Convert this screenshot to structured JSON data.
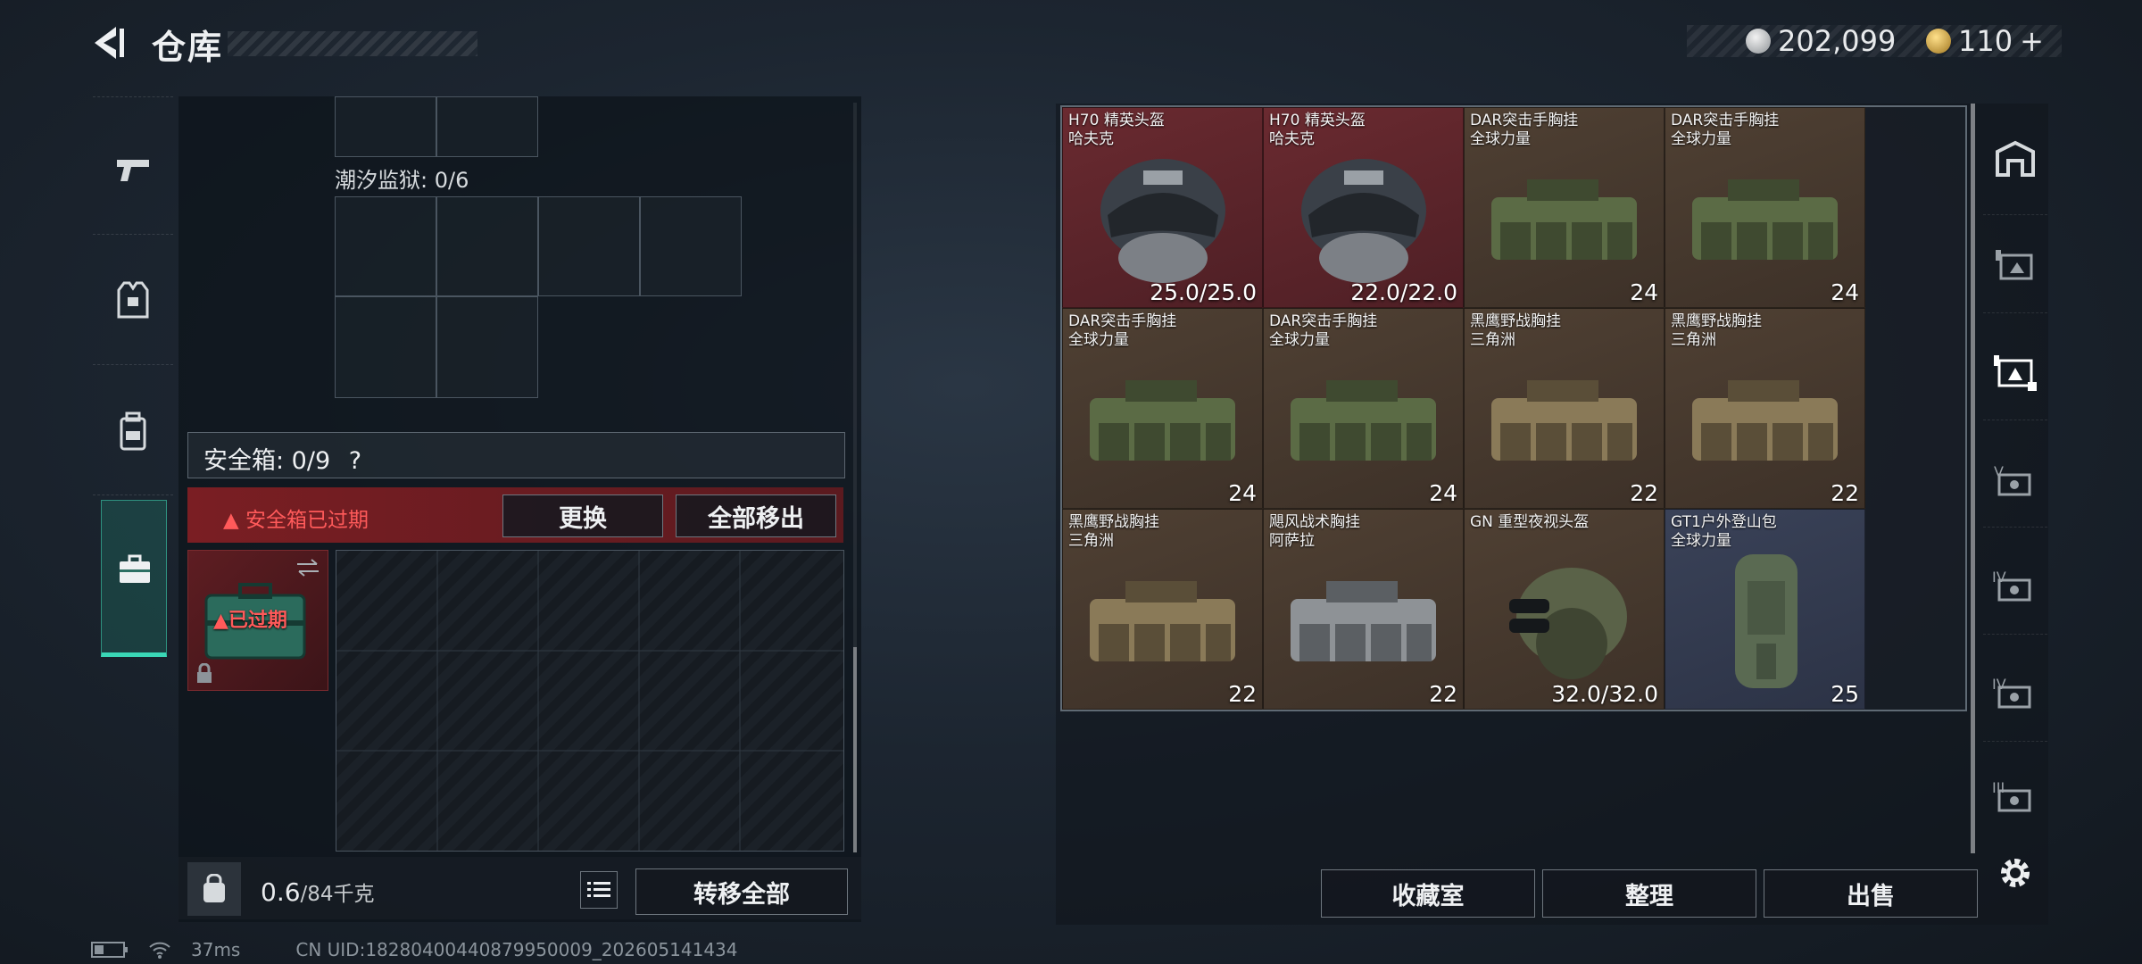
{
  "header": {
    "title": "仓库",
    "currency_silver": "202,099",
    "currency_gold": "110",
    "plus": "+"
  },
  "left_panel": {
    "tide_prison_label": "潮汐监狱: 0/6",
    "safe_box_label": "安全箱: 0/9",
    "safe_box_help": "?",
    "expired_warning": "安全箱已过期",
    "replace_button": "更换",
    "remove_all_button": "全部移出",
    "case_expired_tag": "已过期",
    "weight_value": "0.6",
    "weight_max": "/84千克",
    "transfer_all_button": "转移全部"
  },
  "items": [
    {
      "name": "H70 精英头盔",
      "sub": "哈夫克",
      "value": "25.0/25.0",
      "rarity": "red",
      "icon": "helmet-icon"
    },
    {
      "name": "H70 精英头盔",
      "sub": "哈夫克",
      "value": "22.0/22.0",
      "rarity": "red",
      "icon": "helmet-icon"
    },
    {
      "name": "DAR突击手胸挂",
      "sub": "全球力量",
      "value": "24",
      "rarity": "brown",
      "icon": "chest-rig-icon"
    },
    {
      "name": "DAR突击手胸挂",
      "sub": "全球力量",
      "value": "24",
      "rarity": "brown",
      "icon": "chest-rig-icon"
    },
    {
      "name": "DAR突击手胸挂",
      "sub": "全球力量",
      "value": "24",
      "rarity": "brown",
      "icon": "chest-rig-icon"
    },
    {
      "name": "DAR突击手胸挂",
      "sub": "全球力量",
      "value": "24",
      "rarity": "brown",
      "icon": "chest-rig-icon"
    },
    {
      "name": "黑鹰野战胸挂",
      "sub": "三角洲",
      "value": "22",
      "rarity": "brown",
      "icon": "chest-rig-icon"
    },
    {
      "name": "黑鹰野战胸挂",
      "sub": "三角洲",
      "value": "22",
      "rarity": "brown",
      "icon": "chest-rig-icon"
    },
    {
      "name": "黑鹰野战胸挂",
      "sub": "三角洲",
      "value": "22",
      "rarity": "brown",
      "icon": "chest-rig-icon"
    },
    {
      "name": "飓风战术胸挂",
      "sub": "阿萨拉",
      "value": "22",
      "rarity": "brown",
      "icon": "chest-rig-icon"
    },
    {
      "name": "GN 重型夜视头盔",
      "sub": "",
      "value": "32.0/32.0",
      "rarity": "brown",
      "icon": "nv-helmet-icon"
    },
    {
      "name": "GT1户外登山包",
      "sub": "全球力量",
      "value": "25",
      "rarity": "blue",
      "icon": "backpack-icon"
    }
  ],
  "bottom_buttons": {
    "collection": "收藏室",
    "organize": "整理",
    "sell": "出售"
  },
  "status_bar": {
    "ping": "37ms",
    "uid": "CN UID:18280400440879950009_202605141434"
  },
  "colors": {
    "accent_teal": "#3ad7b6",
    "expired_red": "#ff5a5a",
    "rarity_red": "#6a2a30",
    "rarity_brown": "#4f4033",
    "rarity_blue": "#3a4258"
  }
}
